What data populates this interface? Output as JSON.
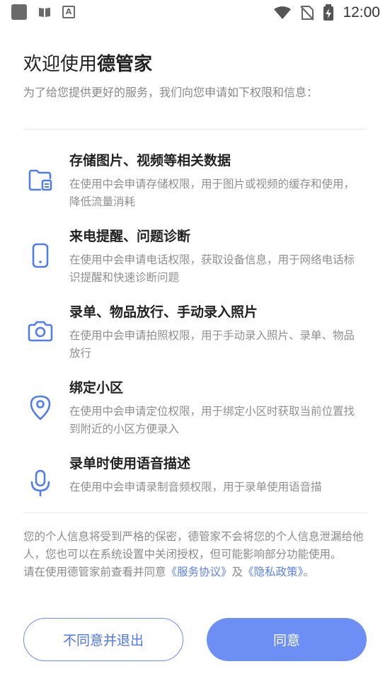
{
  "status_bar": {
    "time": "12:00",
    "left_icons": [
      "app-square-icon",
      "book-icon",
      "font-a-icon"
    ],
    "right_icons": [
      "wifi-icon",
      "no-sim-icon",
      "battery-charging-icon"
    ]
  },
  "header": {
    "title_prefix": "欢迎使用",
    "title_app": "德管家",
    "subtitle": "为了给您提供更好的服务，我们向您申请如下权限和信息："
  },
  "permissions": [
    {
      "icon": "folder-icon",
      "title": "存储图片、视频等相关数据",
      "desc": "在使用中会申请存储权限，用于图片或视频的缓存和使用，降低流量消耗"
    },
    {
      "icon": "phone-icon",
      "title": "来电提醒、问题诊断",
      "desc": "在使用中会申请电话权限，获取设备信息，用于网络电话标识提醒和快速诊断问题"
    },
    {
      "icon": "camera-icon",
      "title": "录单、物品放行、手动录入照片",
      "desc": "在使用中会申请拍照权限，用于手动录入照片、录单、物品放行"
    },
    {
      "icon": "location-icon",
      "title": "绑定小区",
      "desc": "在使用中会申请定位权限，用于绑定小区时获取当前位置找到附近的小区方便录入"
    },
    {
      "icon": "microphone-icon",
      "title": "录单时使用语音描述",
      "desc": "在使用中会申请录制音频权限，用于录单使用语音描"
    }
  ],
  "notice": {
    "privacy_text": "您的个人信息将受到严格的保密，德管家不会将您的个人信息泄漏给他人，您也可以在系统设置中关闭授权，但可能影响部分功能使用。",
    "agreement_prefix": "请在使用德管家前查看并同意",
    "service_link": "《服务协议》",
    "and_text": "及",
    "privacy_link": "《隐私政策》",
    "end": "。"
  },
  "buttons": {
    "decline": "不同意并退出",
    "agree": "同意"
  },
  "colors": {
    "accent": "#6d8ef5",
    "link": "#5a81f3",
    "icon_blue": "#4f7df0"
  }
}
